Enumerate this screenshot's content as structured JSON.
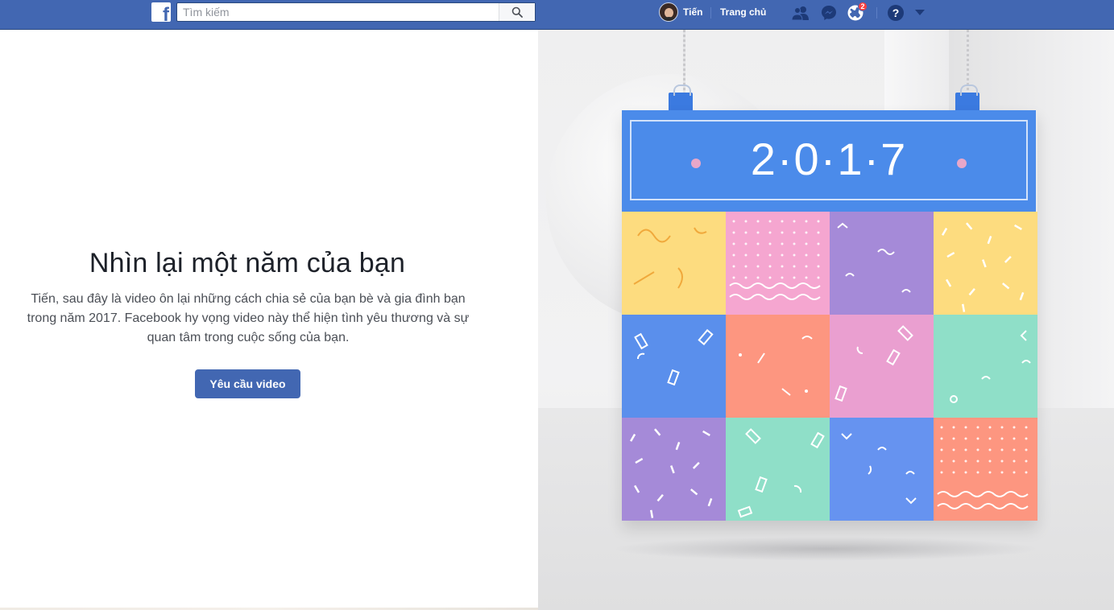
{
  "header": {
    "logo_icon": "facebook-f-logo",
    "search": {
      "placeholder": "Tìm kiếm",
      "value": "",
      "icon": "search-icon"
    },
    "user": {
      "name": "Tiến",
      "avatar": "user-avatar"
    },
    "home_label": "Trang chủ",
    "icons": [
      "friends-icon",
      "messenger-icon",
      "globe-notifications-icon",
      "help-icon",
      "caret-down-icon"
    ],
    "notifications_count": "2",
    "brand_color": "#4267b2"
  },
  "main": {
    "title": "Nhìn lại một năm của bạn",
    "description": "Tiến, sau đây là video ôn lại những cách chia sẻ của bạn bè và gia đình bạn trong năm 2017. Facebook hy vọng video này thể hiện tình yêu thương và sự quan tâm trong cuộc sống của bạn.",
    "cta_label": "Yêu cầu video"
  },
  "hero": {
    "year_text": "2·0·1·7",
    "tile_colors": [
      "#fddc7f",
      "#f5a6d0",
      "#a58ad8",
      "#fddc7f",
      "#5a8fec",
      "#fd9680",
      "#ea9fd0",
      "#8fdfc8",
      "#a58ad8",
      "#8fdfc8",
      "#6693f0",
      "#fd9680"
    ]
  }
}
